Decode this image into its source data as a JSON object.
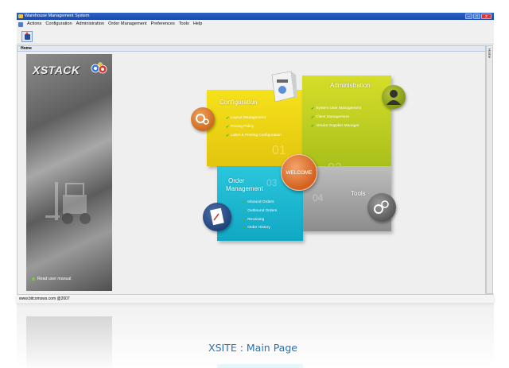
{
  "window": {
    "title": "Warehouse Management System",
    "controls": [
      "–",
      "□",
      "x"
    ]
  },
  "menu": [
    "Actions",
    "Configuration",
    "Administration",
    "Order Management",
    "Preferences",
    "Tools",
    "Help"
  ],
  "tab": {
    "label": "Home",
    "side_label": "Home"
  },
  "sidebar": {
    "brand": "XSTACK",
    "manual_link": "Read user manual"
  },
  "tiles": {
    "configuration": {
      "title": "Configuration",
      "items": [
        "Layout Management",
        "Pricing Policy",
        "Label & Printing Configuration"
      ],
      "number": "01"
    },
    "administration": {
      "title": "Administration",
      "items": [
        "System User Management",
        "Client Management",
        "Vendor Supplier Manager"
      ],
      "number": "02"
    },
    "order": {
      "title_line1": "Order",
      "title_line2": "Management",
      "items": [
        "Inbound Orders",
        "Outbound Orders",
        "Receiving",
        "Order History"
      ],
      "number": "03"
    },
    "tools": {
      "title": "Tools",
      "number": "04"
    }
  },
  "welcome": "WELCOME",
  "status": {
    "text": "www.bitcomsws.com @2007"
  },
  "caption": "XSITE : Main Page"
}
